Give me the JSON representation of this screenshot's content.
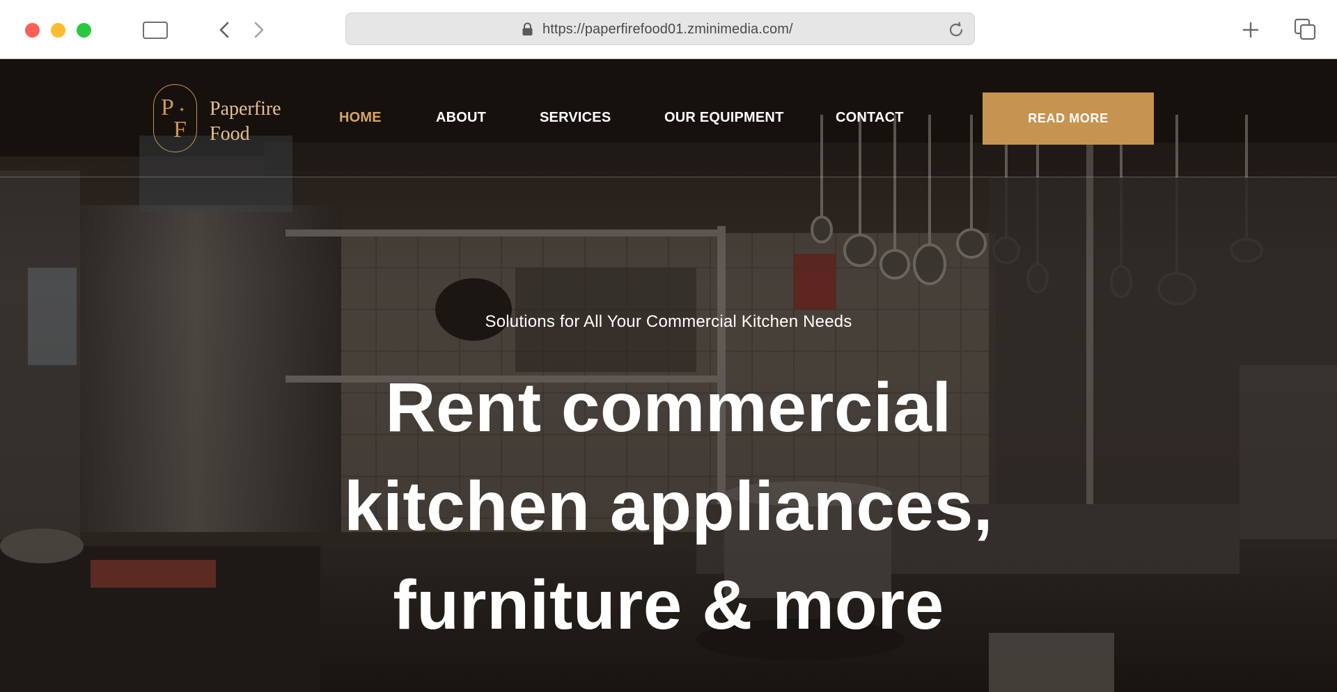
{
  "browser": {
    "url": "https://paperfirefood01.zminimedia.com/"
  },
  "site": {
    "logo": {
      "monogram_p": "P",
      "monogram_f": "F",
      "name_line1": "Paperfire",
      "name_line2": "Food"
    },
    "nav": [
      {
        "label": "HOME",
        "active": true
      },
      {
        "label": "ABOUT",
        "active": false
      },
      {
        "label": "SERVICES",
        "active": false
      },
      {
        "label": "OUR EQUIPMENT",
        "active": false
      },
      {
        "label": "CONTACT",
        "active": false
      }
    ],
    "cta_label": "READ MORE",
    "colors": {
      "accent": "#c69450",
      "active_nav": "#d6a463"
    }
  },
  "hero": {
    "tagline": "Solutions for All Your Commercial Kitchen Needs",
    "heading_lines": [
      "Rent commercial",
      "kitchen appliances,",
      "furniture & more"
    ]
  },
  "icons": {
    "lock": "lock-icon",
    "reload": "reload-icon",
    "new_tab": "plus-icon",
    "tabs": "tabs-overview-icon",
    "sidebar": "sidebar-icon",
    "back": "chevron-left-icon",
    "forward": "chevron-right-icon"
  }
}
